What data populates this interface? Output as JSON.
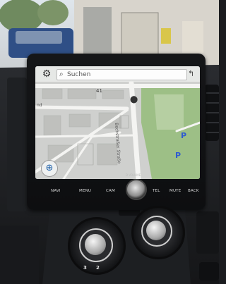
{
  "screen": {
    "search_placeholder": "Suchen",
    "zoom_indicator": "41",
    "road_labels": [
      "nd",
      "Bechstraßer Straße"
    ],
    "parking_symbols": [
      "P",
      "P"
    ]
  },
  "head_unit": {
    "buttons": [
      "NAVI",
      "MENU",
      "CAM",
      "TEL",
      "MUTE",
      "BACK"
    ],
    "knob_label": "Ð VOLUME"
  },
  "hvac": {
    "fan_numbers": [
      "3",
      "2"
    ]
  },
  "colors": {
    "park": "#2f5bd0",
    "green_area": "#9dbf86",
    "map_bg": "#cfd0ce"
  },
  "icons": {
    "settings": "gear-icon",
    "search": "magnifier-icon",
    "location": "crosshair-icon"
  }
}
